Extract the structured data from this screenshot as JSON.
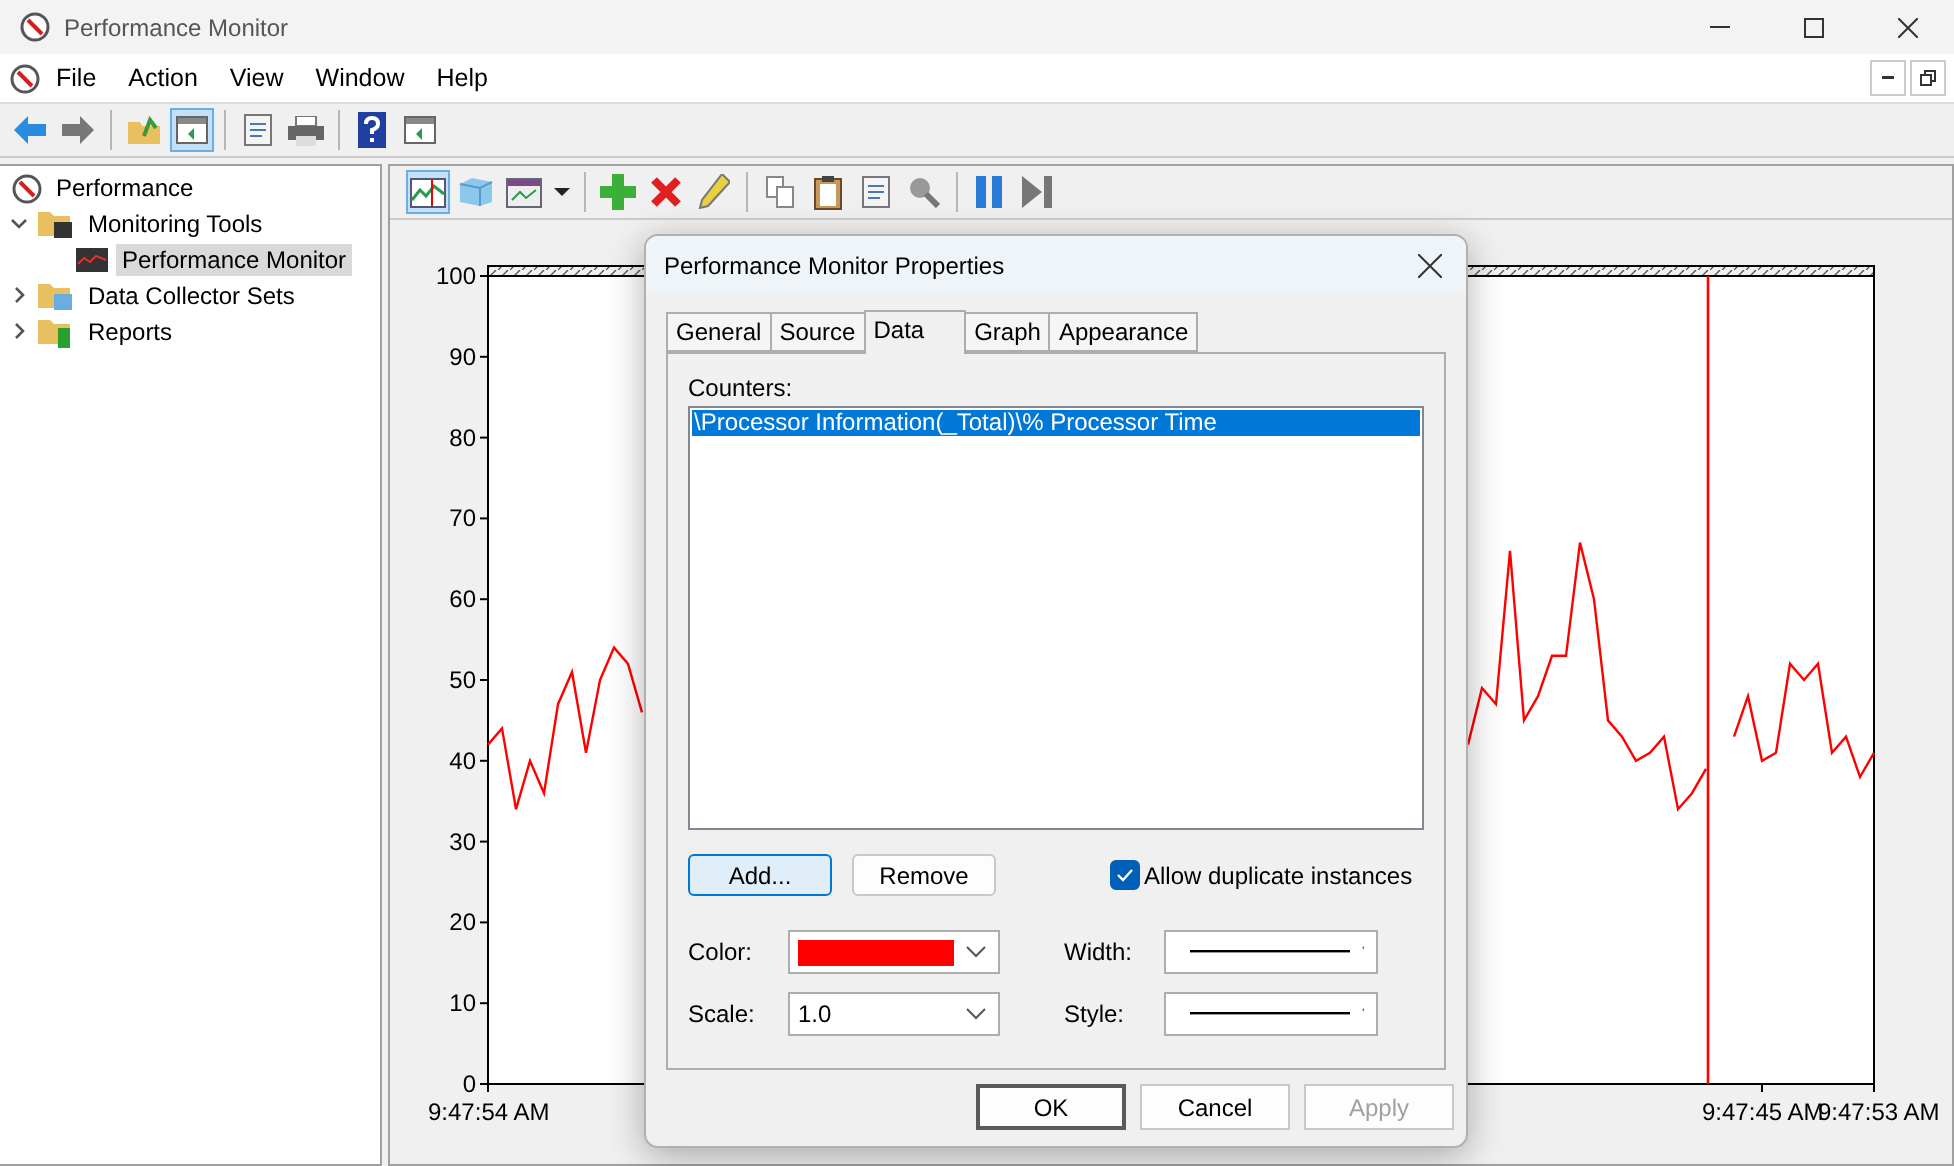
{
  "window": {
    "title": "Performance Monitor"
  },
  "menu": [
    "File",
    "Action",
    "View",
    "Window",
    "Help"
  ],
  "toolbar": [
    {
      "kind": "back",
      "pressed": false
    },
    {
      "kind": "forward",
      "pressed": false
    },
    {
      "kind": "sep"
    },
    {
      "kind": "up",
      "pressed": false
    },
    {
      "kind": "console",
      "pressed": true
    },
    {
      "kind": "sep"
    },
    {
      "kind": "export",
      "pressed": false
    },
    {
      "kind": "print",
      "pressed": false
    },
    {
      "kind": "sep"
    },
    {
      "kind": "help",
      "pressed": false
    },
    {
      "kind": "panel",
      "pressed": false
    }
  ],
  "tree": {
    "label": "Performance",
    "selected": false,
    "children": [
      {
        "label": "Monitoring Tools",
        "kind": "folder-chart",
        "selected": false,
        "expanded": true,
        "children": [
          {
            "label": "Performance Monitor",
            "kind": "monitor",
            "selected": true
          }
        ]
      },
      {
        "label": "Data Collector Sets",
        "kind": "folder-sets",
        "selected": false,
        "expanded": false
      },
      {
        "label": "Reports",
        "kind": "folder-report",
        "selected": false,
        "expanded": false
      }
    ]
  },
  "chart_toolbar": [
    {
      "kind": "graph",
      "pressed": true
    },
    {
      "kind": "histogram",
      "pressed": false
    },
    {
      "kind": "report",
      "pressed": false
    },
    {
      "kind": "caret",
      "pressed": false
    },
    {
      "kind": "sep"
    },
    {
      "kind": "add",
      "pressed": false
    },
    {
      "kind": "delete",
      "pressed": false
    },
    {
      "kind": "highlight",
      "pressed": false
    },
    {
      "kind": "sep"
    },
    {
      "kind": "copy",
      "pressed": false
    },
    {
      "kind": "paste",
      "pressed": false
    },
    {
      "kind": "properties",
      "pressed": false
    },
    {
      "kind": "zoom",
      "pressed": false
    },
    {
      "kind": "sep"
    },
    {
      "kind": "freeze",
      "pressed": false
    },
    {
      "kind": "update",
      "pressed": false
    }
  ],
  "chart_data": {
    "type": "line",
    "ylim": [
      0,
      100
    ],
    "categories": [
      "9:47:54 AM",
      null,
      null,
      null,
      null,
      null,
      null,
      null,
      null,
      null,
      null,
      null,
      null,
      null,
      null,
      null,
      null,
      null,
      null,
      null,
      null,
      null,
      null,
      null,
      null,
      null,
      null,
      null,
      null,
      null,
      null,
      null,
      null,
      null,
      null,
      null,
      null,
      null,
      null,
      null,
      null,
      null,
      null,
      null,
      null,
      null,
      null,
      null,
      null,
      null,
      null,
      null,
      null,
      null,
      null,
      null,
      null,
      null,
      null,
      null,
      null,
      null,
      null,
      null,
      null,
      null,
      null,
      null,
      null,
      null,
      null,
      null,
      null,
      null,
      null,
      null,
      null,
      null,
      null,
      null,
      null,
      null,
      null,
      null,
      null,
      null,
      null,
      null,
      null,
      null,
      null,
      "9:47:45 AM",
      null,
      null,
      null,
      null,
      null,
      null,
      null,
      "9:47:53 AM"
    ],
    "yticks": [
      0,
      10,
      20,
      30,
      40,
      50,
      60,
      70,
      80,
      90,
      100
    ],
    "series": [
      {
        "color": "#ff0000",
        "values": [
          42,
          44,
          34,
          40,
          36,
          47,
          51,
          41,
          50,
          54,
          52,
          46,
          null,
          null,
          null,
          null,
          null,
          null,
          null,
          null,
          null,
          null,
          null,
          null,
          null,
          null,
          null,
          null,
          null,
          null,
          null,
          null,
          null,
          null,
          null,
          null,
          null,
          null,
          null,
          null,
          null,
          null,
          null,
          null,
          null,
          null,
          null,
          null,
          null,
          null,
          null,
          null,
          null,
          null,
          null,
          null,
          null,
          null,
          null,
          null,
          null,
          null,
          null,
          null,
          null,
          null,
          null,
          null,
          null,
          null,
          42,
          49,
          47,
          66,
          45,
          48,
          53,
          53,
          67,
          60,
          45,
          43,
          40,
          41,
          43,
          34,
          36,
          39,
          null,
          43,
          48,
          40,
          41,
          52,
          50,
          52,
          41,
          43,
          38,
          41
        ]
      }
    ]
  },
  "dialog": {
    "title": "Performance Monitor Properties",
    "tabs": [
      {
        "label": "General",
        "selected": false
      },
      {
        "label": "Source",
        "selected": false
      },
      {
        "label": "Data",
        "selected": true
      },
      {
        "label": "Graph",
        "selected": false
      },
      {
        "label": "Appearance",
        "selected": false
      }
    ],
    "counters_label": "Counters:",
    "counters": [
      {
        "text": "\\Processor Information(_Total)\\% Processor Time",
        "selected": true
      }
    ],
    "list_buttons": [
      {
        "label": "Add...",
        "focused": true
      },
      {
        "label": "Remove",
        "focused": false
      }
    ],
    "checkbox": {
      "label": "Allow duplicate instances",
      "checked": true
    },
    "fields": [
      {
        "label": "Color:",
        "kind": "color",
        "color": "#ff0000"
      },
      {
        "label": "Width:",
        "kind": "line"
      },
      {
        "label": "Scale:",
        "kind": "text",
        "value": "1.0"
      },
      {
        "label": "Style:",
        "kind": "line"
      }
    ],
    "buttons": [
      {
        "label": "OK",
        "default": true,
        "disabled": false
      },
      {
        "label": "Cancel",
        "default": false,
        "disabled": false
      },
      {
        "label": "Apply",
        "default": false,
        "disabled": true
      }
    ]
  }
}
